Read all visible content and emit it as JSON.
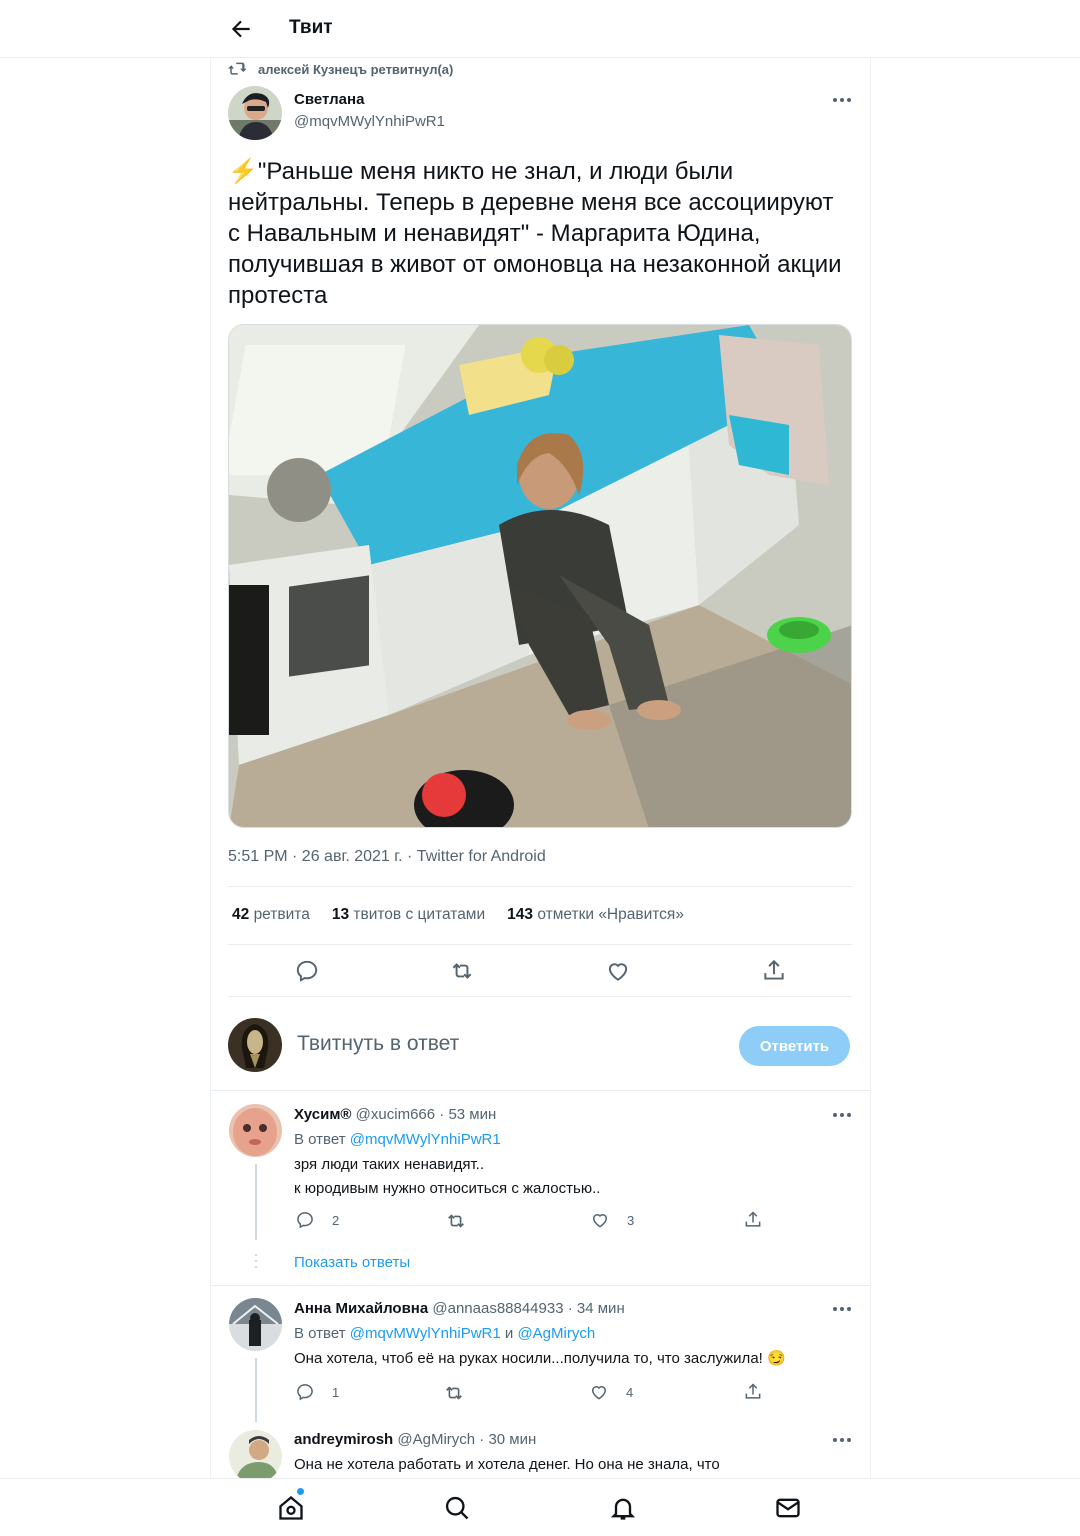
{
  "header": {
    "title": "Твит"
  },
  "retweet_line": "алексей Кузнецъ ретвитнул(а)",
  "tweet": {
    "author_name": "Светлана",
    "author_handle": "@mqvMWylYnhiPwR1",
    "emoji": "⚡",
    "text": "\"Раньше меня никто не знал, и люди были нейтральны. Теперь в деревне меня все ассоциируют с Навальным и ненавидят\" - Маргарита Юдина, получившая в живот от омоновца на незаконной акции протеста",
    "meta": "5:51 PM · 26 авг. 2021 г. · Twitter for Android",
    "stats": {
      "retweets_count": "42",
      "retweets_label": "ретвита",
      "quotes_count": "13",
      "quotes_label": "твитов с цитатами",
      "likes_count": "143",
      "likes_label": "отметки «Нравится»"
    }
  },
  "composer": {
    "placeholder": "Твитнуть в ответ",
    "button": "Ответить"
  },
  "replies": [
    {
      "name": "Хусим®",
      "handle": "@xucim666",
      "time": "· 53 мин",
      "in_reply_prefix": "В ответ",
      "in_reply_to": "@mqvMWylYnhiPwR1",
      "text_line1": "зря люди таких ненавидят..",
      "text_line2": "к юродивым нужно относиться с жалостью..",
      "replies": "2",
      "likes": "3"
    },
    {
      "name": "Анна Михайловна",
      "handle": "@annaas88844933",
      "time": "· 34 мин",
      "in_reply_prefix": "В ответ",
      "in_reply_to": "@mqvMWylYnhiPwR1",
      "in_reply_and": "и",
      "in_reply_to2": "@AgMirych",
      "text_line1": "Она хотела, чтоб её на руках носили...получила то, что заслужила! 😏",
      "replies": "1",
      "likes": "4"
    },
    {
      "name": "andreymirosh",
      "handle": "@AgMirych",
      "time": "· 30 мин",
      "text_line1": "Она не хотела работать и хотела денег. Но она не знала, что"
    }
  ],
  "show_replies": "Показать ответы",
  "colors": {
    "accent": "#1d9bf0",
    "muted": "#536471",
    "button_disabled": "#8ecdf7"
  },
  "icons": {
    "back": "arrow-left-icon",
    "retweet": "retweet-icon",
    "more": "more-icon",
    "reply": "reply-icon",
    "like": "heart-icon",
    "share": "share-icon",
    "home": "home-icon",
    "search": "search-icon",
    "notifications": "bell-icon",
    "messages": "mail-icon"
  }
}
